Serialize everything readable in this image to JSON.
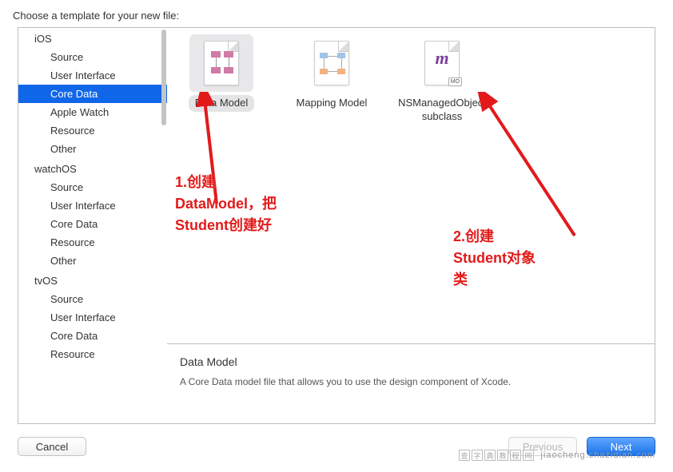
{
  "prompt": "Choose a template for your new file:",
  "sidebar": {
    "groups": [
      {
        "header": "iOS",
        "items": [
          "Source",
          "User Interface",
          "Core Data",
          "Apple Watch",
          "Resource",
          "Other"
        ],
        "selected_index": 2
      },
      {
        "header": "watchOS",
        "items": [
          "Source",
          "User Interface",
          "Core Data",
          "Resource",
          "Other"
        ]
      },
      {
        "header": "tvOS",
        "items": [
          "Source",
          "User Interface",
          "Core Data",
          "Resource"
        ]
      }
    ]
  },
  "templates": [
    {
      "label": "Data Model",
      "icon": "data-model-icon",
      "selected": true
    },
    {
      "label": "Mapping Model",
      "icon": "mapping-model-icon",
      "selected": false
    },
    {
      "label": "NSManagedObject subclass",
      "icon": "nsmanagedobject-icon",
      "selected": false
    }
  ],
  "description": {
    "title": "Data Model",
    "text": "A Core Data model file that allows you to use the design component of Xcode."
  },
  "annotations": {
    "note1": "1.创建\nDataModel，把\nStudent创建好",
    "note2": "2.创建\nStudent对象\n类"
  },
  "buttons": {
    "cancel": "Cancel",
    "previous": "Previous",
    "next": "Next"
  },
  "watermark": {
    "chars": [
      "查",
      "字",
      "典",
      "教",
      "程",
      "网"
    ],
    "url": "jiaocheng.chazidian.com"
  },
  "colors": {
    "selection": "#1066e8",
    "annotation": "#e21a1a"
  }
}
